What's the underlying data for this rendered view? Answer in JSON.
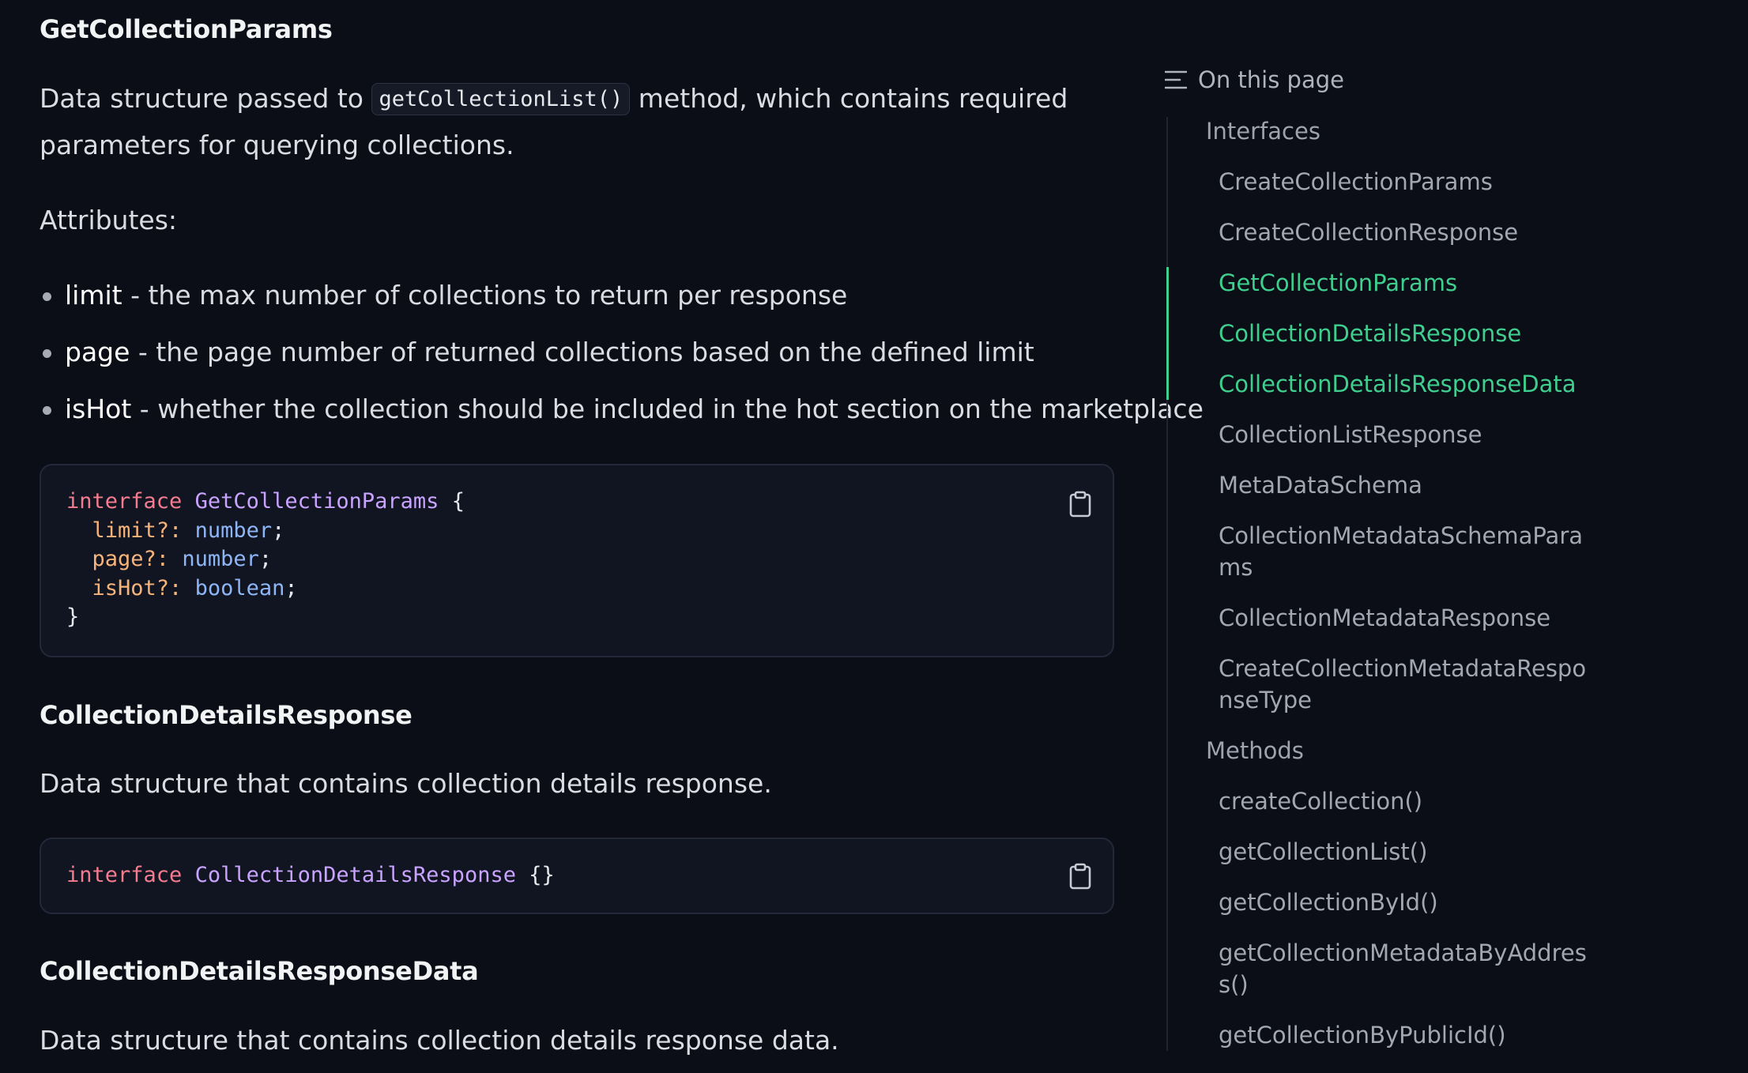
{
  "section1": {
    "title": "GetCollectionParams",
    "desc_before": "Data structure passed to ",
    "desc_code": "getCollectionList()",
    "desc_after": " method, which contains required parameters for querying collections.",
    "attributes_label": "Attributes:",
    "attributes": [
      {
        "term": "limit",
        "text": " - the max number of collections to return per response"
      },
      {
        "term": "page",
        "text": " - the page number of returned collections based on the defined limit"
      },
      {
        "term": "isHot",
        "text": " - whether the collection should be included in the hot section on the marketplace"
      }
    ],
    "code": {
      "kw": "interface",
      "name": "GetCollectionParams",
      "open": "{",
      "fields": [
        {
          "prop": "limit?:",
          "type": "number"
        },
        {
          "prop": "page?:",
          "type": "number"
        },
        {
          "prop": "isHot?:",
          "type": "boolean"
        }
      ],
      "close": "}"
    }
  },
  "section2": {
    "title": "CollectionDetailsResponse",
    "desc": "Data structure that contains collection details response.",
    "code": {
      "kw": "interface",
      "name": "CollectionDetailsResponse",
      "body": "{}"
    }
  },
  "section3": {
    "title": "CollectionDetailsResponseData",
    "desc": "Data structure that contains collection details response data."
  },
  "toc": {
    "header": "On this page",
    "groups": [
      {
        "label": "Interfaces",
        "items": [
          {
            "label": "CreateCollectionParams"
          },
          {
            "label": "CreateCollectionResponse"
          },
          {
            "label": "GetCollectionParams",
            "active": true
          },
          {
            "label": "CollectionDetailsResponse",
            "active": true
          },
          {
            "label": "CollectionDetailsResponseData",
            "active": true
          },
          {
            "label": "CollectionListResponse"
          },
          {
            "label": "MetaDataSchema"
          },
          {
            "label": "CollectionMetadataSchemaPara",
            "label2": "ms"
          },
          {
            "label": "CollectionMetadataResponse"
          },
          {
            "label": "CreateCollectionMetadataRespo",
            "label2": "nseType"
          }
        ]
      },
      {
        "label": "Methods",
        "items": [
          {
            "label": "createCollection()"
          },
          {
            "label": "getCollectionList()"
          },
          {
            "label": "getCollectionById()"
          },
          {
            "label": "getCollectionMetadataByAddres",
            "label2": "s()"
          },
          {
            "label": "getCollectionByPublicId()"
          }
        ]
      }
    ],
    "accent_color": "#3ecf8e"
  }
}
